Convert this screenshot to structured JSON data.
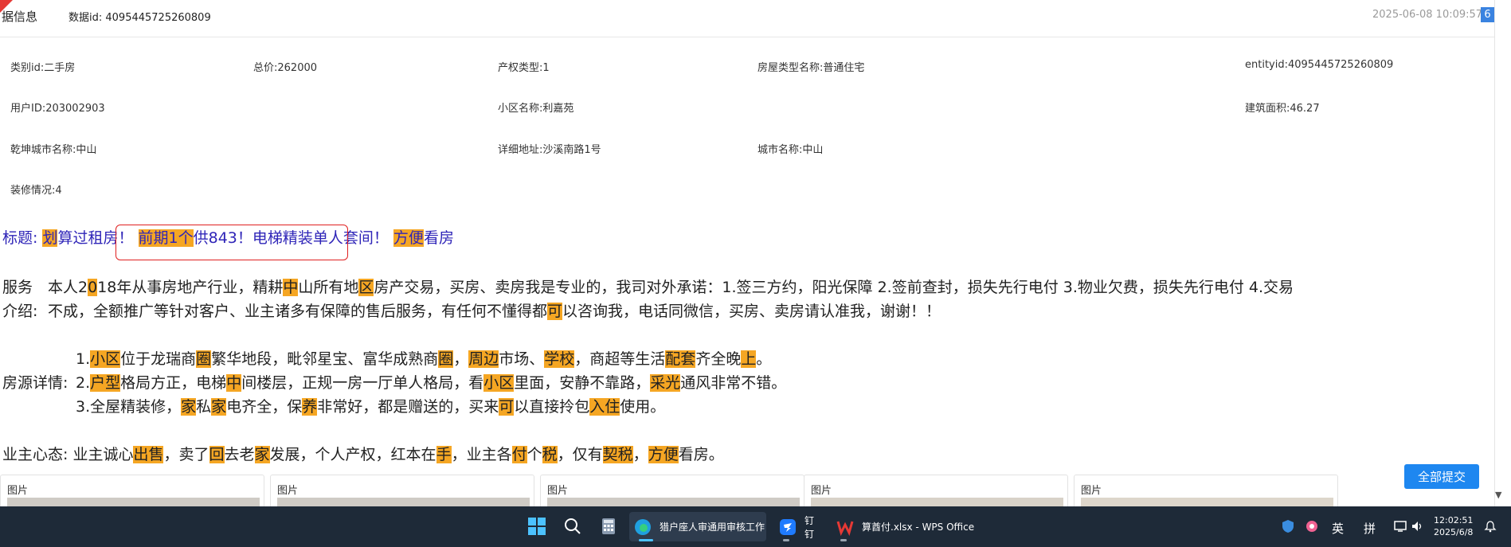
{
  "header": {
    "title": "据信息",
    "data_id": "数据id: 4095445725260809",
    "timestamp": "2025-06-08 10:09:57",
    "badge": "6"
  },
  "fields": {
    "category": "类别id:二手房",
    "total_price": "总价:262000",
    "property_type": "产权类型:1",
    "house_type_name": "房屋类型名称:普通住宅",
    "entity_id": "entityid:4095445725260809",
    "user_id": "用户ID:203002903",
    "community_name": "小区名称:利嘉苑",
    "building_area": "建筑面积:46.27",
    "qiankun_city": "乾坤城市名称:中山",
    "address": "详细地址:沙溪南路1号",
    "city_name": "城市名称:中山",
    "decoration": "装修情况:4"
  },
  "listing": {
    "title_label": "标题: ",
    "title_segments": [
      {
        "t": "划",
        "h": true
      },
      {
        "t": "算过租房！ ",
        "h": false
      },
      {
        "t": "前期1个",
        "h": true
      },
      {
        "t": "供843！电梯精装单人套间！ ",
        "h": false
      },
      {
        "t": "方便",
        "h": true
      },
      {
        "t": "看房",
        "h": false
      }
    ],
    "service_label_1": "服务",
    "service_label_2": "介绍:",
    "service_line1": [
      {
        "t": "本人2",
        "h": false
      },
      {
        "t": "0",
        "h": true
      },
      {
        "t": "18年从事房地产行业，精耕",
        "h": false
      },
      {
        "t": "中",
        "h": true
      },
      {
        "t": "山所有地",
        "h": false
      },
      {
        "t": "区",
        "h": true
      },
      {
        "t": "房产交易，买房、卖房我是专业的，我司对外承诺：1.签三方约，阳光保障 2.签前查封，损失先行电付 3.物业欠费，损失先行电付 4.交易",
        "h": false
      }
    ],
    "service_line2": [
      {
        "t": "不成，全额推广等针对客户、业主诸多有保障的售后服务，有任何不懂得都",
        "h": false
      },
      {
        "t": "可",
        "h": true
      },
      {
        "t": "以咨询我，电话同微信，买房、卖房请认准我，谢谢！！",
        "h": false
      }
    ],
    "details_label": "房源详情:",
    "detail1": [
      {
        "t": "1.",
        "h": false
      },
      {
        "t": "小区",
        "h": true
      },
      {
        "t": "位于龙瑞商",
        "h": false
      },
      {
        "t": "圈",
        "h": true
      },
      {
        "t": "繁华地段，毗邻星宝、富华成熟商",
        "h": false
      },
      {
        "t": "圈",
        "h": true
      },
      {
        "t": "，",
        "h": false
      },
      {
        "t": "周边",
        "h": true
      },
      {
        "t": "市场、",
        "h": false
      },
      {
        "t": "学校",
        "h": true
      },
      {
        "t": "，商超等生活",
        "h": false
      },
      {
        "t": "配套",
        "h": true
      },
      {
        "t": "齐全晚",
        "h": false
      },
      {
        "t": "上",
        "h": true
      },
      {
        "t": "。",
        "h": false
      }
    ],
    "detail2": [
      {
        "t": "2.",
        "h": false
      },
      {
        "t": "户型",
        "h": true
      },
      {
        "t": "格局方正，电梯",
        "h": false
      },
      {
        "t": "中",
        "h": true
      },
      {
        "t": "间楼层，正规一房一厅单人格局，看",
        "h": false
      },
      {
        "t": "小区",
        "h": true
      },
      {
        "t": "里面，安静不靠路，",
        "h": false
      },
      {
        "t": "采光",
        "h": true
      },
      {
        "t": "通风非常不错。",
        "h": false
      }
    ],
    "detail3": [
      {
        "t": "3.全屋精装修，",
        "h": false
      },
      {
        "t": "家",
        "h": true
      },
      {
        "t": "私",
        "h": false
      },
      {
        "t": "家",
        "h": true
      },
      {
        "t": "电齐全，保",
        "h": false
      },
      {
        "t": "养",
        "h": true
      },
      {
        "t": "非常好，都是赠送的，买来",
        "h": false
      },
      {
        "t": "可",
        "h": true
      },
      {
        "t": "以直接拎包",
        "h": false
      },
      {
        "t": "入住",
        "h": true
      },
      {
        "t": "使用。",
        "h": false
      }
    ],
    "owner_label": "业主心态: ",
    "owner_segments": [
      {
        "t": "业主诚心",
        "h": false
      },
      {
        "t": "出售",
        "h": true
      },
      {
        "t": "，卖了",
        "h": false
      },
      {
        "t": "回",
        "h": true
      },
      {
        "t": "去老",
        "h": false
      },
      {
        "t": "家",
        "h": true
      },
      {
        "t": "发展，个人产权，红本在",
        "h": false
      },
      {
        "t": "手",
        "h": true
      },
      {
        "t": "，业主各",
        "h": false
      },
      {
        "t": "付",
        "h": true
      },
      {
        "t": "个",
        "h": false
      },
      {
        "t": "税",
        "h": true
      },
      {
        "t": "，仅有",
        "h": false
      },
      {
        "t": "契税",
        "h": true
      },
      {
        "t": "，",
        "h": false
      },
      {
        "t": "方便",
        "h": true
      },
      {
        "t": "看房。",
        "h": false
      }
    ]
  },
  "image_cards": [
    "图片",
    "图片",
    "图片",
    "图片",
    "图片"
  ],
  "submit_label": "全部提交",
  "taskbar": {
    "apps": [
      {
        "label": "猎户座人审通用审核工作"
      },
      {
        "label": "钉钉"
      },
      {
        "label": "算酋付.xlsx - WPS Office"
      }
    ],
    "ime_lang": "英",
    "ime_mode": "拼",
    "time": "12:02:51",
    "date": "2025/6/8"
  },
  "colors": {
    "highlight": "#f5a623",
    "title_text": "#2f25b8",
    "accent": "#1e87f0",
    "taskbar": "#1e2a38"
  }
}
